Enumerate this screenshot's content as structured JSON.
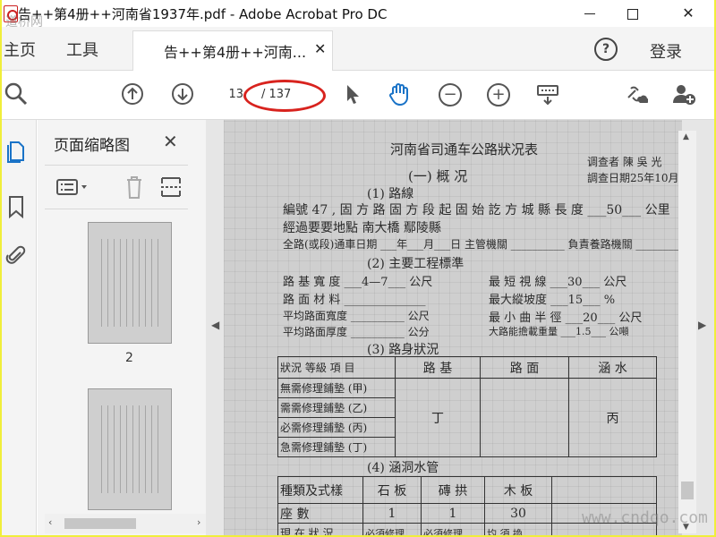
{
  "window": {
    "title": "告++第4册++河南省1937年.pdf - Adobe Acrobat Pro DC",
    "watermark_top": "道桥网",
    "watermark_bottom": "www.cndqo.com"
  },
  "tabs": {
    "home": "主页",
    "tools": "工具",
    "document": "告++第4册++河南...",
    "login": "登录"
  },
  "toolbar": {
    "current_page": "13",
    "total_pages": "/ 137",
    "icons": [
      "search-zoom-icon",
      "page-up-icon",
      "page-down-icon",
      "select-arrow-icon",
      "hand-pan-icon",
      "zoom-out-icon",
      "zoom-in-icon",
      "keyboard-scroll-icon",
      "share-link-icon",
      "add-user-icon"
    ]
  },
  "thumbnails": {
    "title": "页面缩略图",
    "page_labels": [
      "2"
    ]
  },
  "document": {
    "title": "河南省司通车公路狀况表",
    "section1": "(一) 概  况",
    "investigator": "调查者 陳 吳 光",
    "date": "調查日期25年10月",
    "sub1": "(1) 路線",
    "line1": "編號 47 , 固 方 路 固 方 段 起 固 始 訖 方 城 縣 長 度 ___50___ 公里",
    "line2": "經過要要地點 南大橋 鄢陵縣",
    "line3": "全路(或段)通車日期 ___年___月___日 主管機關 __________ 負責養路機關 ________",
    "sub2": "(2) 主要工程標準",
    "spec_left": [
      "路 基 寬 度 ___4—7___ 公尺",
      "路 面 材 料 ______________",
      "平均路面寬度 __________ 公尺",
      "平均路面厚度 __________ 公分"
    ],
    "spec_right": [
      "最 短 視 線 ___30___ 公尺",
      "最大縱坡度 ___15___ %",
      "最 小 曲 半 徑 ___20___ 公尺",
      "大路能擔載重量 ___1.5___ 公噸"
    ],
    "sub3": "(3) 路身狀況",
    "table1": {
      "header": [
        "狀況  等級  項 目",
        "路  基",
        "路  面",
        "涵  水"
      ],
      "rows": [
        "無需修理鋪墊 (甲)",
        "需需修理鋪墊 (乙)",
        "必需修理鋪墊 (丙)",
        "急需修理鋪墊 (丁)"
      ],
      "marks": [
        "丁",
        "丙"
      ]
    },
    "sub4": "(4) 涵洞水管",
    "table2": {
      "header": [
        "種類及式樣",
        "石  板",
        "磚  拱",
        "木  板"
      ],
      "row1": [
        "座  數",
        "1",
        "1",
        "30"
      ],
      "row2": [
        "現 在 狀 況",
        "必須修理",
        "必須修理",
        "均 須 換"
      ]
    }
  }
}
